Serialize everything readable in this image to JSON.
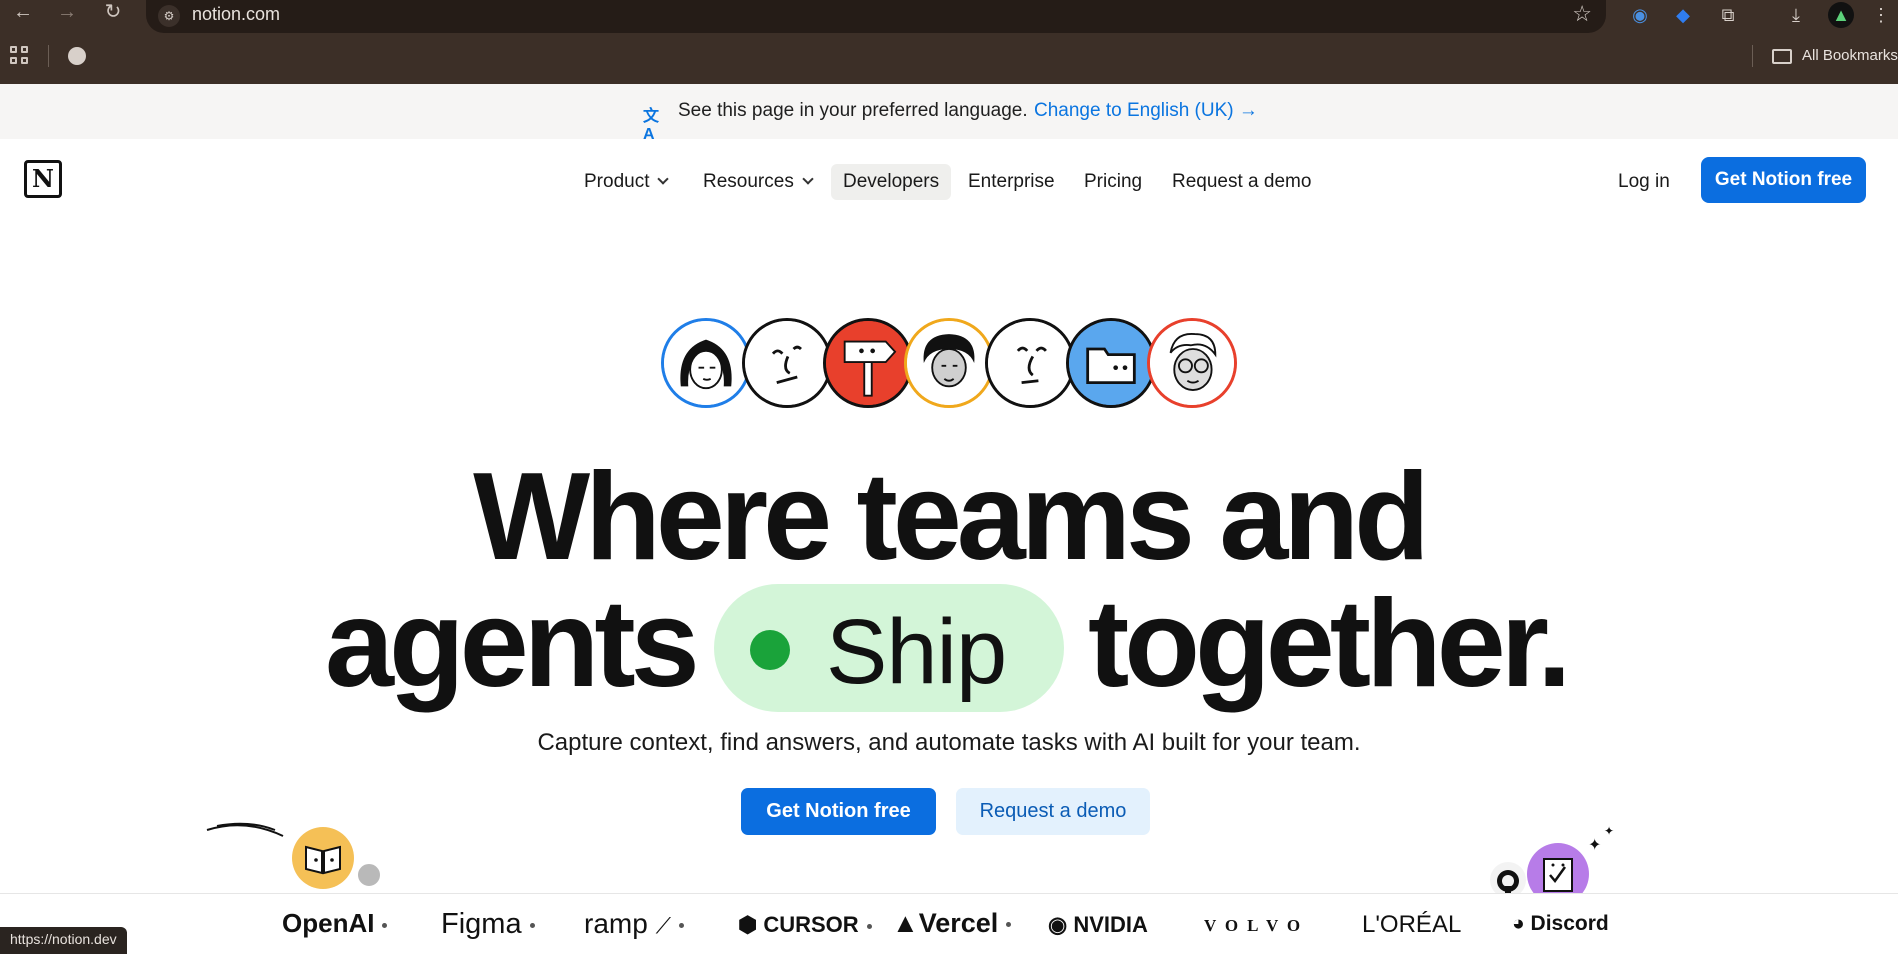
{
  "browser": {
    "url": "notion.com",
    "bookmarks_label": "All Bookmarks",
    "status_url": "https://notion.dev"
  },
  "banner": {
    "text": "See this page in your preferred language.",
    "link": "Change to English (UK) →"
  },
  "header": {
    "logo_letter": "N",
    "nav": [
      {
        "label": "Product",
        "has_dropdown": true
      },
      {
        "label": "Resources",
        "has_dropdown": true
      },
      {
        "label": "Developers",
        "active": true
      },
      {
        "label": "Enterprise"
      },
      {
        "label": "Pricing"
      },
      {
        "label": "Request a demo"
      }
    ],
    "login": "Log in",
    "cta": "Get Notion free"
  },
  "hero": {
    "line1": "Where teams and",
    "line2_left": "agents",
    "pill_word": "Ship",
    "line2_right": "together.",
    "subtitle": "Capture context, find answers, and automate tasks with AI built for your team.",
    "primary_cta": "Get Notion free",
    "secondary_cta": "Request a demo"
  },
  "logos": [
    "OpenAI",
    "Figma",
    "ramp",
    "CURSOR",
    "Vercel",
    "NVIDIA",
    "VOLVO",
    "L'ORÉAL",
    "Discord"
  ],
  "colors": {
    "accent": "#0b6ee0",
    "pill_bg": "#d3f5d8",
    "pill_dot": "#1aa33a",
    "browser_chrome": "#3c2f27"
  }
}
